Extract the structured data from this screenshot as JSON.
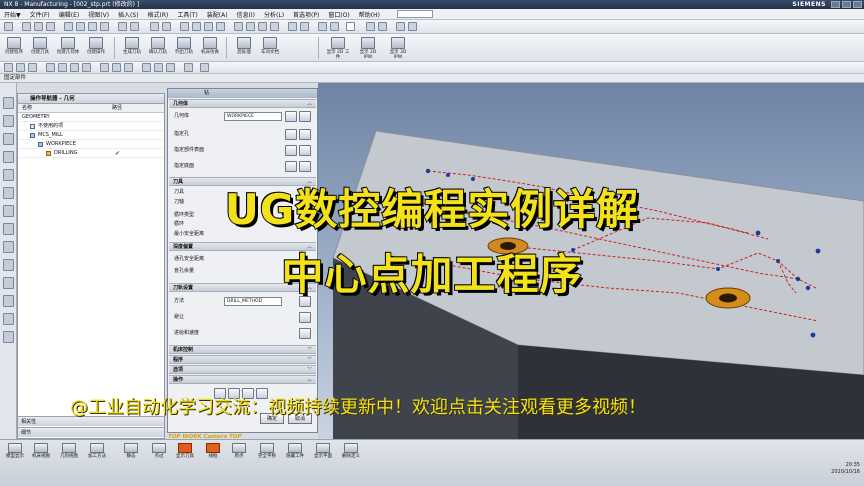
{
  "titlebar": {
    "title": "NX 8 - Manufacturing - [002_stp.prt (修改的) ]",
    "brand": "SIEMENS"
  },
  "menubar": {
    "items": [
      "开始▼",
      "文件(F)",
      "编辑(E)",
      "视图(V)",
      "插入(S)",
      "格式(R)",
      "工具(T)",
      "装配(A)",
      "信息(I)",
      "分析(L)",
      "首选项(P)",
      "窗口(O)",
      "帮助(H)"
    ]
  },
  "toolbar2": {
    "buttons": [
      "创建程序",
      "创建刀具",
      "创建几何体",
      "创建操作",
      "生成刀轨",
      "确认刀轨",
      "列出刀轨",
      "机床仿真",
      "后处理",
      "车间文档",
      "显示 2D 工件",
      "显示 2D IPW",
      "显示 3D IPW"
    ]
  },
  "navstrip": {
    "label": "固定部件"
  },
  "opnav": {
    "title": "操作导航器 - 几何",
    "col_name": "名称",
    "col_path": "路径",
    "rows": [
      {
        "label": "GEOMETRY",
        "indent": 0
      },
      {
        "label": "不使用的项",
        "indent": 1
      },
      {
        "label": "MCS_MILL",
        "indent": 1
      },
      {
        "label": "WORKPIECE",
        "indent": 2
      },
      {
        "label": "DRILLING",
        "indent": 3,
        "status": "✔"
      }
    ],
    "footer1": "相关性",
    "footer2": "细节"
  },
  "dialog": {
    "title": "钻",
    "sections": {
      "geometry": "几何体",
      "tool": "刀具",
      "depth_offset": "深度偏置",
      "path_settings": "刀轨设置",
      "machine_control": "机床控制",
      "program": "程序",
      "options": "选项",
      "actions": "操作"
    },
    "rows": {
      "geometry_label": "几何体",
      "geometry_value": "WORKPIECE",
      "specify_holes": "指定孔",
      "specify_top": "指定部件表面",
      "specify_bottom": "指定底面",
      "tool_label": "刀具",
      "axis_label": "刀轴",
      "cycle_type": "循环类型",
      "cycle": "循环",
      "min_safe": "最小安全距离",
      "through_safe": "通孔安全距离",
      "blind_offset": "盲孔余量",
      "method_label": "方法",
      "method_value": "DRILL_METHOD",
      "avoid": "避让",
      "feeds": "进给和速度"
    },
    "ok": "确定",
    "cancel": "取消"
  },
  "camera": "TOP WORK Camera TOP",
  "taskbar": {
    "buttons": [
      "模型显示",
      "机床视图",
      "几何视图",
      "加工方法",
      "静态",
      "点过",
      "显示刀具",
      "线框",
      "原点"
    ],
    "right_buttons": [
      "完全平移",
      "隐藏工件",
      "显示平面",
      "删除定义"
    ],
    "time": "20:35",
    "date": "2020/10/16"
  },
  "overlay": {
    "title_line1": "UG数控编程实例详解",
    "title_line2": "中心点加工程序",
    "scroll_text": "@工业自动化学习交流：视频持续更新中！欢迎点击关注观看更多视频！"
  }
}
